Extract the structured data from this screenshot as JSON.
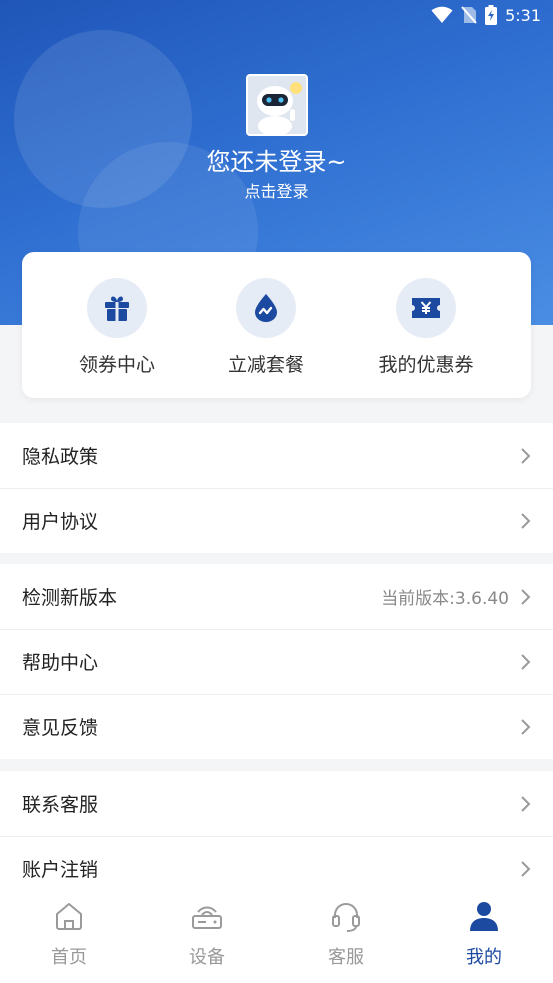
{
  "status_bar": {
    "time": "5:31"
  },
  "profile": {
    "title": "您还未登录~",
    "subtitle": "点击登录"
  },
  "quick_actions": [
    {
      "label": "领券中心",
      "icon": "gift-icon"
    },
    {
      "label": "立减套餐",
      "icon": "drop-wave-icon"
    },
    {
      "label": "我的优惠券",
      "icon": "coupon-yen-icon"
    }
  ],
  "menu_groups": [
    [
      {
        "label": "隐私政策"
      },
      {
        "label": "用户协议"
      }
    ],
    [
      {
        "label": "检测新版本",
        "value": "当前版本:3.6.40"
      },
      {
        "label": "帮助中心"
      },
      {
        "label": "意见反馈"
      }
    ],
    [
      {
        "label": "联系客服"
      },
      {
        "label": "账户注销"
      }
    ]
  ],
  "tabbar": [
    {
      "label": "首页",
      "icon": "home-icon"
    },
    {
      "label": "设备",
      "icon": "router-icon"
    },
    {
      "label": "客服",
      "icon": "headset-icon"
    },
    {
      "label": "我的",
      "icon": "person-icon",
      "active": true
    }
  ],
  "colors": {
    "accent": "#1c4aa0",
    "header_start": "#1f56b8",
    "header_end": "#4a8ee4"
  }
}
